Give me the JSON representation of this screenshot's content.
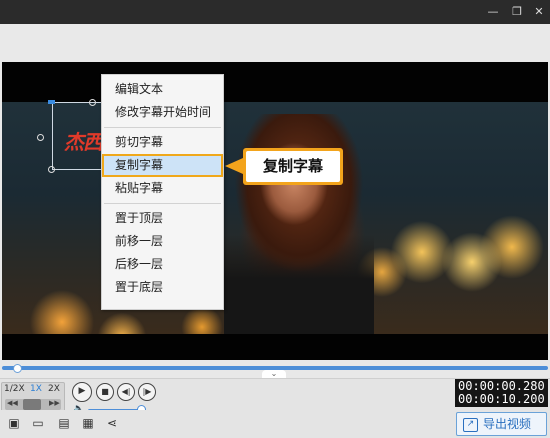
{
  "window": {
    "min_icon": "minimize-icon",
    "max_icon": "restore-icon",
    "close_icon": "close-icon"
  },
  "preview": {
    "subtitle_text": "杰西"
  },
  "context_menu": {
    "groups": [
      [
        "编辑文本",
        "修改字幕开始时间"
      ],
      [
        "剪切字幕",
        "复制字幕",
        "粘贴字幕"
      ],
      [
        "置于顶层",
        "前移一层",
        "后移一层",
        "置于底层"
      ]
    ],
    "highlighted": "复制字幕"
  },
  "callout": {
    "text": "复制字幕"
  },
  "playback": {
    "speeds": [
      "1/2X",
      "1X",
      "2X"
    ],
    "active_speed": "1X",
    "current_time": "00:00:00.280",
    "total_time": "00:00:10.200",
    "progress": 0.028,
    "volume": 0.95
  },
  "toolbar": {
    "export_label": "导出视频",
    "icons": [
      "subtitle-icon",
      "folder-open-icon",
      "save-icon",
      "save-as-icon",
      "share-icon"
    ]
  },
  "colors": {
    "accent": "#f3a41c",
    "progress": "#4d8ed8",
    "highlight": "#cde3f7",
    "subtitle_red": "#e03a2a"
  }
}
